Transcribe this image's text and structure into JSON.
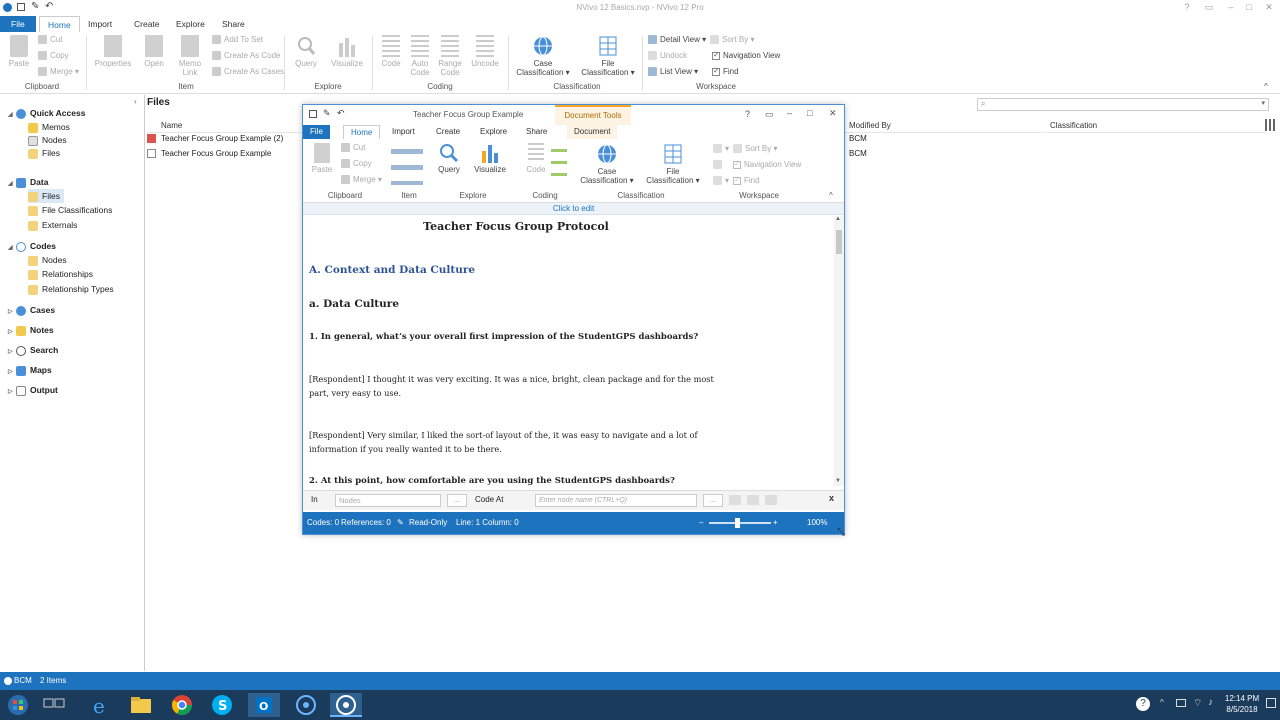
{
  "app": {
    "window_title": "NVivo 12 Basics.nvp - NVivo 12 Pro",
    "ribbon_tabs": [
      "File",
      "Home",
      "Import",
      "Create",
      "Explore",
      "Share"
    ],
    "active_tab": "Home"
  },
  "ribbon": {
    "clipboard": {
      "paste": "Paste",
      "cut": "Cut",
      "copy": "Copy",
      "merge": "Merge",
      "group": "Clipboard"
    },
    "item": {
      "properties": "Properties",
      "open": "Open",
      "memo_link": "Memo Link",
      "add_to_set": "Add To Set",
      "create_as_code": "Create As Code",
      "create_as_cases": "Create As Cases",
      "group": "Item"
    },
    "explore": {
      "query": "Query",
      "visualize": "Visualize",
      "group": "Explore"
    },
    "coding": {
      "code": "Code",
      "auto_code": "Auto Code",
      "range_code": "Range Code",
      "uncode": "Uncode",
      "group": "Coding"
    },
    "classification": {
      "case": "Case Classification",
      "file": "File Classification",
      "group": "Classification"
    },
    "workspace": {
      "detail_view": "Detail View",
      "sort_by": "Sort By",
      "undock": "Undock",
      "navigation_view": "Navigation View",
      "list_view": "List View",
      "find": "Find",
      "group": "Workspace"
    }
  },
  "nav": {
    "quick_access": "Quick Access",
    "qa_items": [
      "Memos",
      "Nodes",
      "Files"
    ],
    "data": "Data",
    "data_items": [
      "Files",
      "File Classifications",
      "Externals"
    ],
    "codes": "Codes",
    "codes_items": [
      "Nodes",
      "Relationships",
      "Relationship Types"
    ],
    "sections": [
      "Cases",
      "Notes",
      "Search",
      "Maps",
      "Output"
    ]
  },
  "list": {
    "title": "Files",
    "columns": {
      "name": "Name",
      "modified_by": "Modified By",
      "classification": "Classification"
    },
    "rows": [
      {
        "name": "Teacher Focus Group Example (2)",
        "modified_by": "BCM"
      },
      {
        "name": "Teacher Focus Group Example",
        "modified_by": "BCM"
      }
    ]
  },
  "docwin": {
    "title": "Teacher Focus Group Example",
    "context_tab": "Document Tools",
    "tabs": [
      "File",
      "Home",
      "Import",
      "Create",
      "Explore",
      "Share",
      "Document"
    ],
    "ribbon": {
      "paste": "Paste",
      "cut": "Cut",
      "copy": "Copy",
      "merge": "Merge",
      "query": "Query",
      "visualize": "Visualize",
      "code": "Code",
      "case": "Case Classification",
      "file": "File Classification",
      "sort_by": "Sort By",
      "navigation_view": "Navigation View",
      "find": "Find",
      "groups": [
        "Clipboard",
        "Item",
        "Explore",
        "Coding",
        "Classification",
        "Workspace"
      ]
    },
    "click_to_edit": "Click to edit",
    "document": {
      "title": "Teacher Focus Group Protocol",
      "section": "A. Context and Data Culture",
      "subsection": "a. Data Culture",
      "q1": "1. In general, what’s your overall first impression of the StudentGPS dashboards?",
      "r1": "[Respondent] I thought it was very exciting. It was a nice, bright, clean package and for the most part, very easy to use.",
      "r2": "[Respondent] Very similar, I liked the sort-of layout of the, it was easy to navigate and a lot of information if you really wanted it to be there.",
      "q2": "2. At this point, how comfortable are you using the StudentGPS dashboards?"
    },
    "codeat": {
      "in_label": "In",
      "nodes_placeholder": "Nodes",
      "code_at": "Code At",
      "node_placeholder": "Enter node name (CTRL+Q)"
    },
    "status": {
      "codes": "Codes: 0",
      "references": "References: 0",
      "readonly": "Read-Only",
      "line": "Line: 1 Column: 0",
      "zoom": "100%"
    }
  },
  "status": {
    "user": "BCM",
    "items": "2 Items"
  },
  "taskbar": {
    "time": "12:14 PM",
    "date": "8/5/2018"
  },
  "colors": {
    "accent": "#1e73be",
    "context_tab": "#f5a623",
    "taskbar": "#1b3b5c"
  }
}
